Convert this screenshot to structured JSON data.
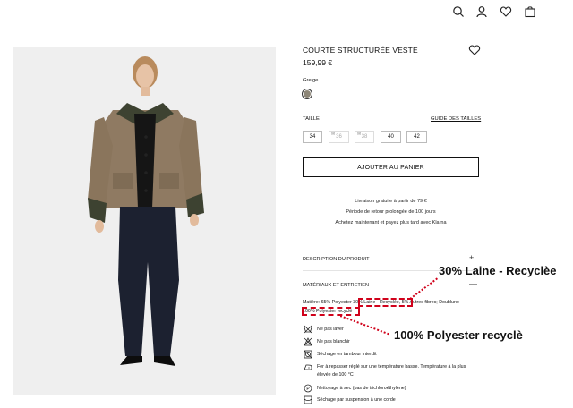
{
  "header": {
    "icons": [
      "search-icon",
      "user-icon",
      "heart-icon",
      "bag-icon"
    ]
  },
  "product": {
    "title": "COURTE STRUCTURÉE VESTE",
    "price": "159,99 €",
    "color_label": "Greige",
    "size_label": "TAILLE",
    "size_guide": "GUIDE DES TAILLES",
    "sizes": [
      {
        "label": "34",
        "available": true
      },
      {
        "label": "36",
        "available": false
      },
      {
        "label": "38",
        "available": false
      },
      {
        "label": "40",
        "available": true
      },
      {
        "label": "42",
        "available": true
      }
    ],
    "add_to_cart": "AJOUTER AU PANIER"
  },
  "shipping": {
    "line1": "Livraison gratuite à partir de 79 €",
    "line2": "Période de retour prolongée de 100 jours",
    "line3": "Achetez maintenant et payez plus tard avec Klarna"
  },
  "accordion": {
    "description": "DESCRIPTION DU PRODUIT",
    "description_toggle": "+",
    "materials": "MATÉRIAUX ET ENTRETIEN",
    "materials_toggle": "—",
    "composition_line1": "Matière: 65% Polyester 30% Laine - Recyclée, 5% Autres fibres; Doublure:",
    "composition_line2": "100% Polyester recyclé"
  },
  "care": [
    {
      "icon": "no-wash-icon",
      "text": "Ne pas laver"
    },
    {
      "icon": "no-bleach-icon",
      "text": "Ne pas blanchir"
    },
    {
      "icon": "tumble-dry-icon",
      "text": "Séchage en tambour interdit"
    },
    {
      "icon": "iron-icon",
      "text": "Fer à repasser réglé sur une température basse. Température à la plus"
    },
    {
      "icon": "",
      "text": "élevée de 100 °C"
    },
    {
      "icon": "dry-clean-icon",
      "text": "Nettoyage à sec (pas de trichloroéthylène)"
    },
    {
      "icon": "line-dry-icon",
      "text": "Séchage par suspension à une corde"
    }
  ],
  "annotations": {
    "wool": "30% Laine - Recyclèe",
    "polyester": "100% Polyester recyclè",
    "color": "#d0021b"
  }
}
